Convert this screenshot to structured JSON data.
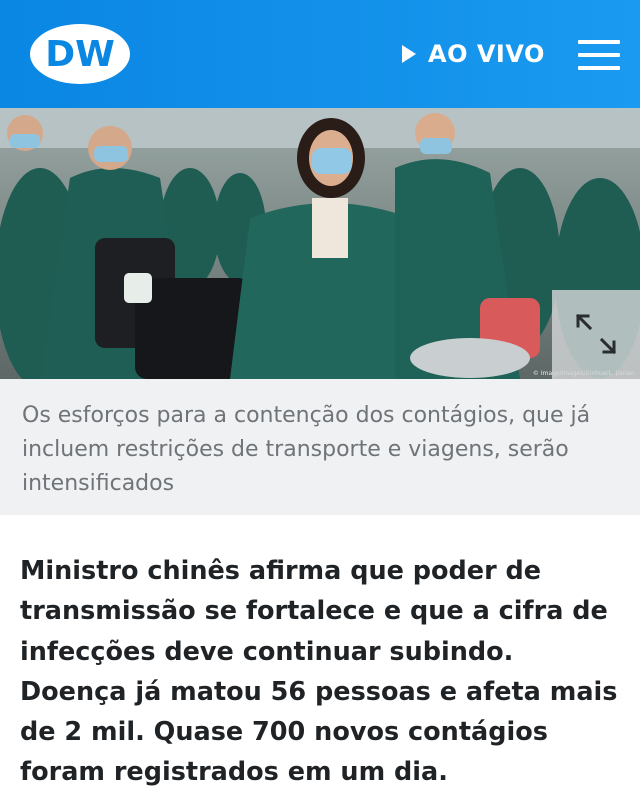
{
  "header": {
    "logo_text": "DW",
    "live_label": "AO VIVO",
    "brand_color": "#0a86e3"
  },
  "photo": {
    "credit": "© Imago/Images/Xinhua/L. Jianan",
    "expand_icon": "expand-arrows-icon"
  },
  "caption": "Os esforços para a contenção dos contágios, que já incluem restrições de transporte e viagens, serão intensificados",
  "lead": "Ministro chinês afirma que poder de transmissão se fortalece e que a cifra de infecções deve continuar subindo. Doença já matou 56 pessoas e afeta mais de 2 mil. Quase 700 novos contágios foram registrados em um dia."
}
